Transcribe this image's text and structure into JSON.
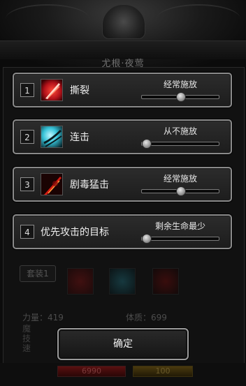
{
  "header": {
    "title": "尤根·夜莺"
  },
  "colors": {
    "row_border": "#8a8a8a",
    "slider_track": "#0a0a0a",
    "slider_thumb": "#bdbdbd",
    "skill_red": "#c0161a",
    "skill_cyan": "#37c3d8"
  },
  "rows": [
    {
      "num": "1",
      "icon": "rend-skill-icon",
      "name": "撕裂",
      "option": "经常施放",
      "level": 0.5
    },
    {
      "num": "2",
      "icon": "combo-skill-icon",
      "name": "连击",
      "option": "从不施放",
      "level": 0.0
    },
    {
      "num": "3",
      "icon": "poison-strike-skill-icon",
      "name": "剧毒猛击",
      "option": "经常施放",
      "level": 0.5
    },
    {
      "num": "4",
      "name": "优先攻击的目标",
      "option": "剩余生命最少",
      "level": 0.0
    }
  ],
  "background": {
    "suit_label": "套装1",
    "stat_strength": "力量：419",
    "stat_constitution": "体质：699",
    "side_labels": [
      "魔",
      "技",
      "速"
    ],
    "resource_red": "6990",
    "resource_gold": "100"
  },
  "confirm_label": "确定"
}
